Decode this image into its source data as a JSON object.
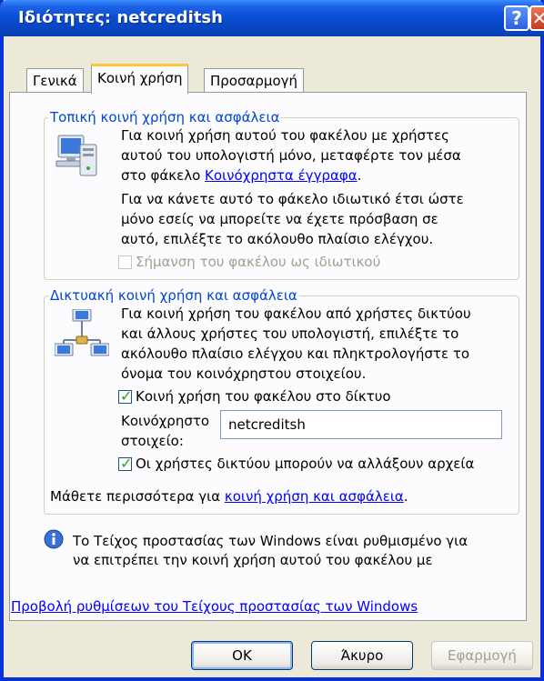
{
  "window": {
    "title": "Ιδιότητες: netcreditsh"
  },
  "titlebar": {
    "help_glyph": "?",
    "close_glyph": "✕"
  },
  "tabs": [
    {
      "label": "Γενικά"
    },
    {
      "label": "Κοινή χρήση"
    },
    {
      "label": "Προσαρμογή"
    }
  ],
  "local_section": {
    "legend": "Τοπική κοινή χρήση και ασφάλεια",
    "line1": "Για κοινή χρήση αυτού του φακέλου με χρήστες",
    "line2": "αυτού του υπολογιστή μόνο, μεταφέρτε τον μέσα",
    "line3_prefix": "στο φάκελο ",
    "line3_link": "Κοινόχρηστα έγγραφα",
    "line3_suffix": ".",
    "private_line1": "Για να κάνετε αυτό το φάκελο ιδιωτικό έτσι ώστε",
    "private_line2": "μόνο εσείς να μπορείτε να έχετε πρόσβαση σε",
    "private_line3": "αυτό, επιλέξτε το ακόλουθο πλαίσιο ελέγχου.",
    "private_checkbox_label": "Σήμανση του φακέλου ως ιδιωτικού"
  },
  "network_section": {
    "legend": "Δικτυακή κοινή χρήση και ασφάλεια",
    "line1": "Για κοινή χρήση του φακέλου από χρήστες δικτύου",
    "line2": "και άλλους χρήστες του υπολογιστή, επιλέξτε το",
    "line3": "ακόλουθο πλαίσιο ελέγχου και πληκτρολογήστε το",
    "line4": "όνομα του κοινόχρηστου στοιχείου.",
    "share_checkbox_label": "Κοινή χρήση του φακέλου στο δίκτυο",
    "share_name_label1": "Κοινόχρηστο",
    "share_name_label2": "στοιχείο:",
    "share_name_value": "netcreditsh",
    "allow_change_label": "Οι χρήστες δικτύου μπορούν να αλλάξουν αρχεία"
  },
  "learn_more": {
    "prefix": "Μάθετε περισσότερα για ",
    "link": "κοινή χρήση και ασφάλεια",
    "suffix": "."
  },
  "firewall_info": {
    "line1": "Το Τείχος προστασίας των Windows είναι ρυθμισμένο για",
    "line2": "να επιτρέπει την κοινή χρήση αυτού του φακέλου με",
    "link": "Προβολή ρυθμίσεων του Τείχους προστασίας των Windows"
  },
  "buttons": {
    "ok": "OK",
    "cancel": "Άκυρο",
    "apply": "Εφαρμογή"
  }
}
